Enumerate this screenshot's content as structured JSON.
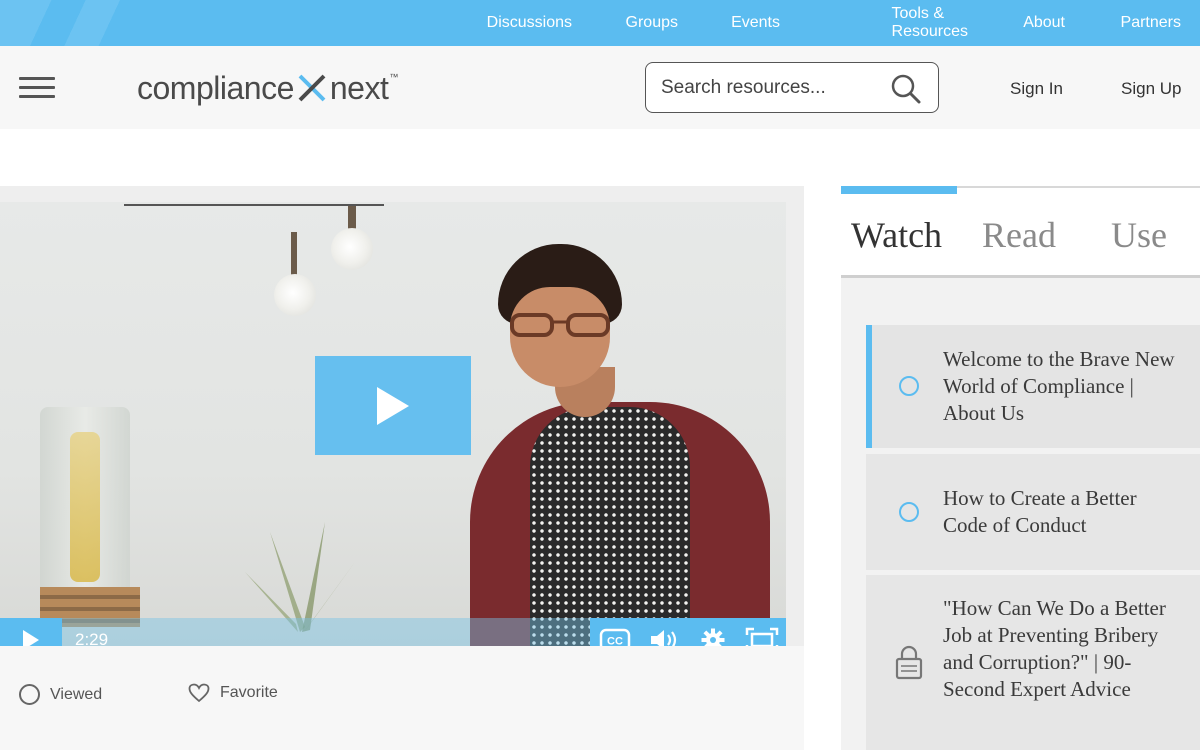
{
  "topnav": {
    "items": [
      "Discussions",
      "Groups",
      "Events",
      "Tools & Resources",
      "About",
      "Partners"
    ]
  },
  "header": {
    "logo_left": "compliance",
    "logo_right": "next",
    "logo_tm": "™",
    "search_placeholder": "Search resources...",
    "signin": "Sign In",
    "signup": "Sign Up"
  },
  "player": {
    "time": "2:29"
  },
  "actions": {
    "viewed": "Viewed",
    "favorite": "Favorite"
  },
  "tabs": [
    "Watch",
    "Read",
    "Use"
  ],
  "playlist": [
    {
      "title": "Welcome to the Brave New World of Compliance | About Us",
      "status": "unwatched",
      "active": true
    },
    {
      "title": "How to Create a Better Code of Conduct",
      "status": "unwatched",
      "active": false
    },
    {
      "title": "\"How Can We Do a Better Job at Preventing Bribery and Corruption?\" | 90-Second Expert Advice",
      "status": "locked",
      "active": false
    }
  ],
  "colors": {
    "accent": "#5bbcf0",
    "header_bg": "#f7f7f7",
    "panel_bg": "#f2f2f2"
  }
}
